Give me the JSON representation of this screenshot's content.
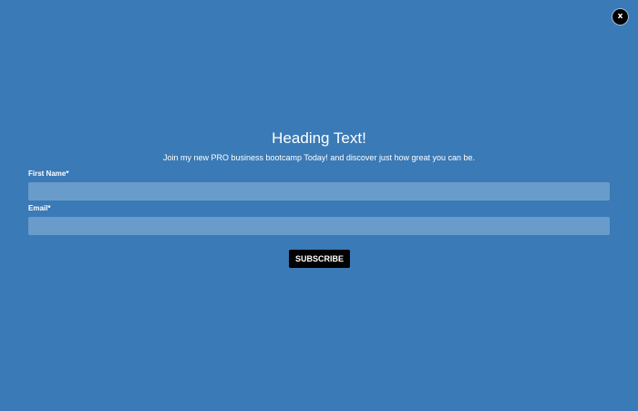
{
  "close_button": {
    "label": "x"
  },
  "heading": "Heading Text!",
  "subtext": "Join my new PRO business bootcamp Today! and discover just how great you can be.",
  "form": {
    "first_name": {
      "label": "First Name*",
      "value": "",
      "placeholder": ""
    },
    "email": {
      "label": "Email*",
      "value": "",
      "placeholder": ""
    },
    "submit_label": "SUBSCRIBE"
  },
  "colors": {
    "background": "#3a7ab6",
    "input_background": "#6a9ccb",
    "button_background": "#000000",
    "text": "#ffffff"
  }
}
